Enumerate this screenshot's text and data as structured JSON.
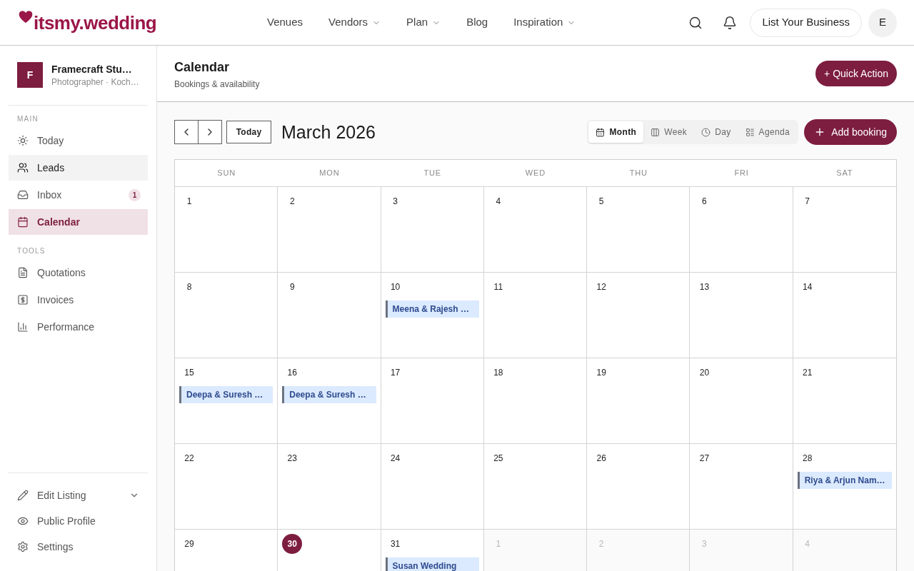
{
  "nav": {
    "logo": "itsmy.wedding",
    "links": [
      {
        "label": "Venues",
        "has_menu": false
      },
      {
        "label": "Vendors",
        "has_menu": true
      },
      {
        "label": "Plan",
        "has_menu": true
      },
      {
        "label": "Blog",
        "has_menu": false
      },
      {
        "label": "Inspiration",
        "has_menu": true
      }
    ],
    "cta": "List Your Business",
    "avatar": "E"
  },
  "sidebar": {
    "profile": {
      "initial": "F",
      "name": "Framecraft Stu…",
      "subtitle": "Photographer · Koch…"
    },
    "sections": [
      {
        "label": "MAIN",
        "items": [
          {
            "label": "Today",
            "selected": false,
            "highlighted": false
          },
          {
            "label": "Leads",
            "selected": false,
            "highlighted": true
          },
          {
            "label": "Inbox",
            "selected": false,
            "highlighted": false,
            "badge": "1"
          },
          {
            "label": "Calendar",
            "selected": true,
            "highlighted": false
          }
        ]
      },
      {
        "label": "TOOLS",
        "items": [
          {
            "label": "Quotations",
            "selected": false,
            "highlighted": false
          },
          {
            "label": "Invoices",
            "selected": false,
            "highlighted": false
          },
          {
            "label": "Performance",
            "selected": false,
            "highlighted": false
          }
        ]
      }
    ],
    "footer": [
      {
        "label": "Edit Listing",
        "has_menu": true
      },
      {
        "label": "Public Profile",
        "has_menu": false
      },
      {
        "label": "Settings",
        "has_menu": false
      }
    ]
  },
  "header": {
    "title": "Calendar",
    "subtitle": "Bookings & availability",
    "action": "+ Quick Action"
  },
  "toolbar": {
    "today": "Today",
    "period": "March 2026",
    "views": [
      {
        "label": "Month",
        "selected": true
      },
      {
        "label": "Week",
        "selected": false
      },
      {
        "label": "Day",
        "selected": false
      },
      {
        "label": "Agenda",
        "selected": false
      }
    ],
    "add": "Add booking"
  },
  "calendar": {
    "weekdays": [
      "SUN",
      "MON",
      "TUE",
      "WED",
      "THU",
      "FRI",
      "SAT"
    ],
    "weeks": [
      [
        {
          "day": "1",
          "outside_month": false,
          "today": false
        },
        {
          "day": "2",
          "outside_month": false,
          "today": false
        },
        {
          "day": "3",
          "outside_month": false,
          "today": false
        },
        {
          "day": "4",
          "outside_month": false,
          "today": false
        },
        {
          "day": "5",
          "outside_month": false,
          "today": false
        },
        {
          "day": "6",
          "outside_month": false,
          "today": false
        },
        {
          "day": "7",
          "outside_month": false,
          "today": false
        }
      ],
      [
        {
          "day": "8",
          "outside_month": false,
          "today": false
        },
        {
          "day": "9",
          "outside_month": false,
          "today": false
        },
        {
          "day": "10",
          "outside_month": false,
          "today": false,
          "events": [
            {
              "title": "Meena & Rajesh …"
            }
          ]
        },
        {
          "day": "11",
          "outside_month": false,
          "today": false
        },
        {
          "day": "12",
          "outside_month": false,
          "today": false
        },
        {
          "day": "13",
          "outside_month": false,
          "today": false
        },
        {
          "day": "14",
          "outside_month": false,
          "today": false
        }
      ],
      [
        {
          "day": "15",
          "outside_month": false,
          "today": false,
          "events": [
            {
              "title": "Deepa & Suresh …"
            }
          ]
        },
        {
          "day": "16",
          "outside_month": false,
          "today": false,
          "events": [
            {
              "title": "Deepa & Suresh …"
            }
          ]
        },
        {
          "day": "17",
          "outside_month": false,
          "today": false
        },
        {
          "day": "18",
          "outside_month": false,
          "today": false
        },
        {
          "day": "19",
          "outside_month": false,
          "today": false
        },
        {
          "day": "20",
          "outside_month": false,
          "today": false
        },
        {
          "day": "21",
          "outside_month": false,
          "today": false
        }
      ],
      [
        {
          "day": "22",
          "outside_month": false,
          "today": false
        },
        {
          "day": "23",
          "outside_month": false,
          "today": false
        },
        {
          "day": "24",
          "outside_month": false,
          "today": false
        },
        {
          "day": "25",
          "outside_month": false,
          "today": false
        },
        {
          "day": "26",
          "outside_month": false,
          "today": false
        },
        {
          "day": "27",
          "outside_month": false,
          "today": false
        },
        {
          "day": "28",
          "outside_month": false,
          "today": false,
          "events": [
            {
              "title": "Riya & Arjun Nam…"
            }
          ]
        }
      ],
      [
        {
          "day": "29",
          "outside_month": false,
          "today": false
        },
        {
          "day": "30",
          "outside_month": false,
          "today": true
        },
        {
          "day": "31",
          "outside_month": false,
          "today": false,
          "events": [
            {
              "title": "Susan Wedding"
            }
          ]
        },
        {
          "day": "1",
          "outside_month": true,
          "today": false
        },
        {
          "day": "2",
          "outside_month": true,
          "today": false
        },
        {
          "day": "3",
          "outside_month": true,
          "today": false
        },
        {
          "day": "4",
          "outside_month": true,
          "today": false
        }
      ]
    ]
  }
}
